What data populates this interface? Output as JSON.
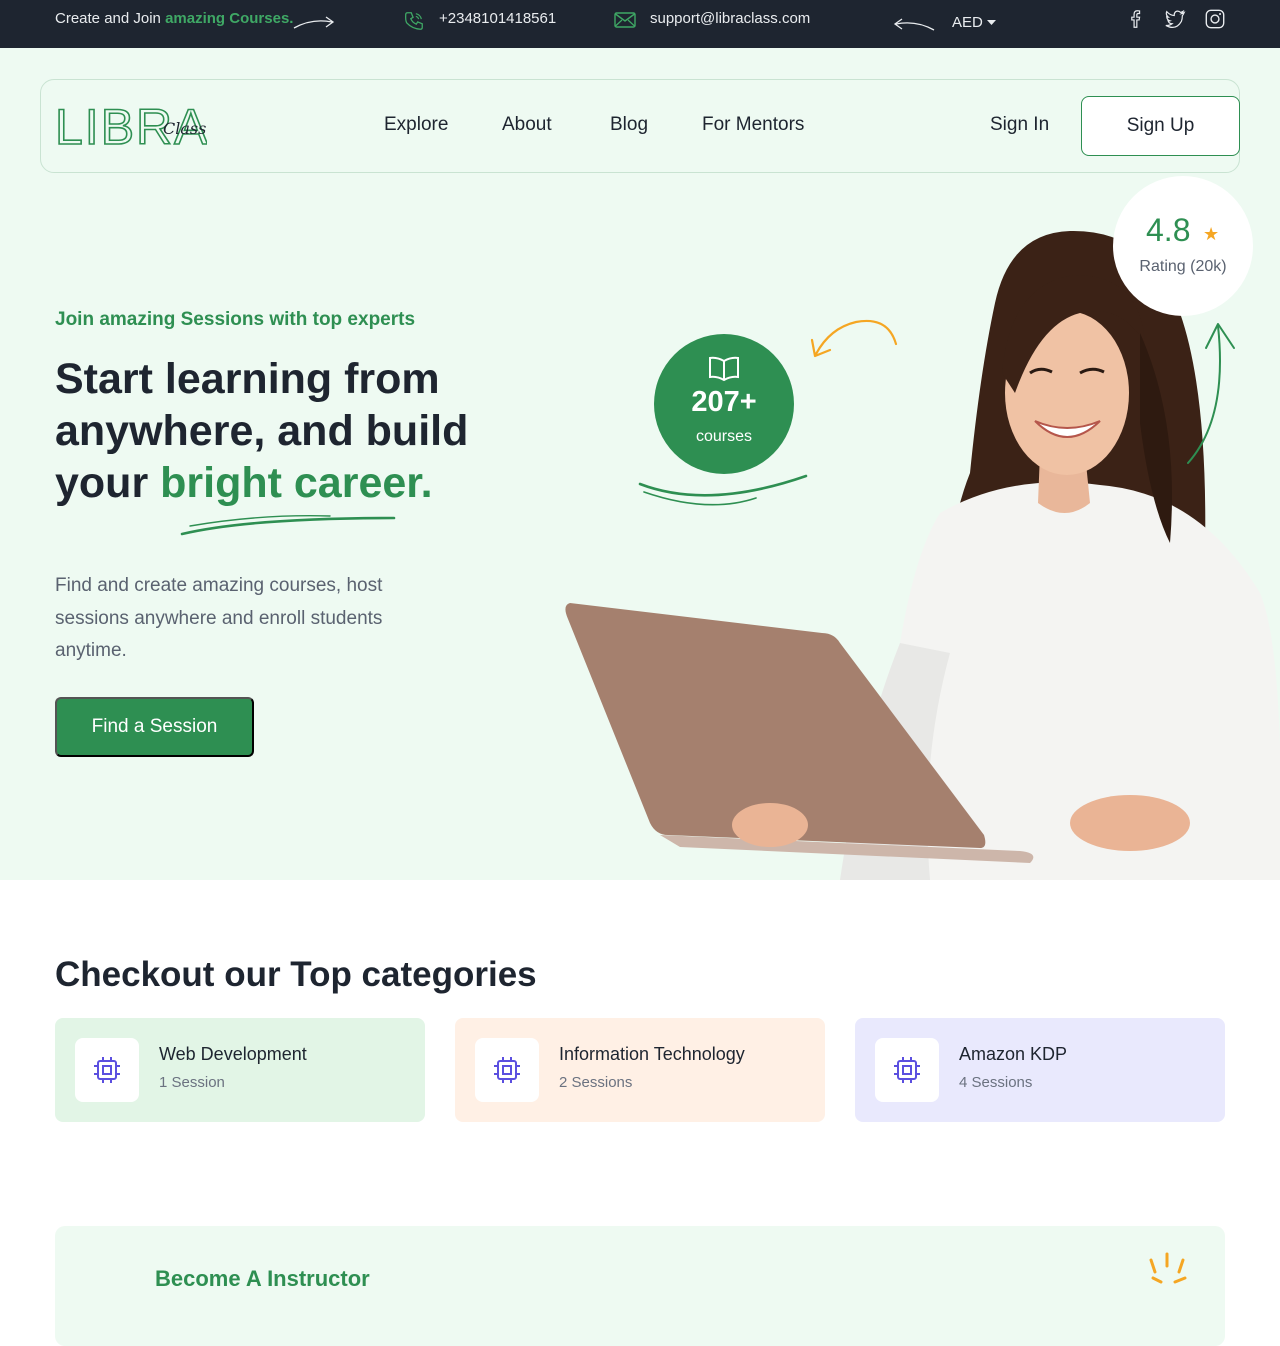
{
  "topbar": {
    "promo_prefix": "Create and Join",
    "promo_highlight": "amazing Courses.",
    "phone": "+2348101418561",
    "email": "support@libraclass.com",
    "currency": "AED",
    "social": [
      "facebook-icon",
      "twitter-icon",
      "instagram-icon"
    ]
  },
  "nav": {
    "logo_main": "LIBRA",
    "logo_script": "Class",
    "links": [
      "Explore",
      "About",
      "Blog",
      "For Mentors"
    ],
    "sign_in": "Sign In",
    "sign_up": "Sign Up"
  },
  "hero": {
    "kicker": "Join amazing Sessions with top experts",
    "headline_1": "Start learning from anywhere, and build your",
    "headline_accent": "bright career.",
    "lead": "Find and create amazing courses, host sessions anywhere and enroll students anytime.",
    "cta": "Find a Session",
    "courses_count": "207+",
    "courses_label": "courses",
    "rating": "4.8",
    "rating_count": "Rating (20k)"
  },
  "categories": {
    "title": "Checkout our Top categories",
    "items": [
      {
        "name": "Web Development",
        "count": "1 Session",
        "bg": "#e2f5e6"
      },
      {
        "name": "Information Technology",
        "count": "2 Sessions",
        "bg": "#fff0e5"
      },
      {
        "name": "Amazon KDP",
        "count": "4 Sessions",
        "bg": "#e9e9fd"
      }
    ]
  },
  "instructor": {
    "title": "Become A Instructor"
  },
  "colors": {
    "brand": "#2e8f52",
    "dark": "#1e2530",
    "accent_orange": "#f5a623",
    "icon_purple": "#5b4fe0"
  }
}
